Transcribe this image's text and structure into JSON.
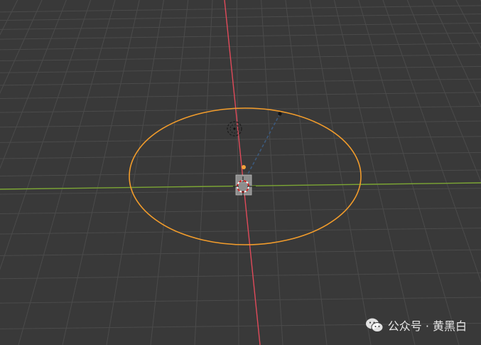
{
  "viewport": {
    "background_color": "#393939",
    "grid_color": "#4b4b4b",
    "x_axis_color": "#e04a5a",
    "y_axis_color": "#7ca634",
    "selection_color": "#f29c2b",
    "empty_color": "#1a1a1a",
    "light_line_color": "#2e3f55"
  },
  "scene_objects": [
    {
      "name": "circle",
      "kind": "mesh-circle",
      "selected": true
    },
    {
      "name": "camera",
      "kind": "camera"
    },
    {
      "name": "light",
      "kind": "spot-light"
    },
    {
      "name": "3d-cursor",
      "kind": "cursor"
    }
  ],
  "watermark": {
    "text": "公众号 · 黄黑白",
    "icon": "wechat-icon"
  }
}
